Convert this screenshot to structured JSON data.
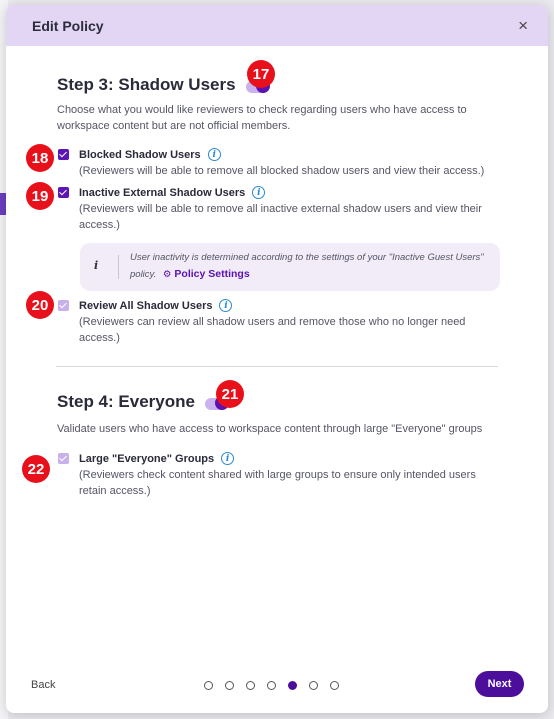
{
  "modal": {
    "title": "Edit Policy",
    "close_label": "×"
  },
  "step3": {
    "title": "Step 3: Shadow Users",
    "toggle_on": true,
    "description": "Choose what you would like reviewers to check regarding users who have access to workspace content but are not official members.",
    "options": [
      {
        "label": "Blocked Shadow Users",
        "checked": true,
        "description": "(Reviewers will be able to remove all blocked shadow users and view their access.)"
      },
      {
        "label": "Inactive External Shadow Users",
        "checked": true,
        "description": "(Reviewers will be able to remove all inactive external shadow users and view their access.)"
      },
      {
        "label": "Review All Shadow Users",
        "checked": true,
        "disabled": true,
        "description": "(Reviewers can review all shadow users and remove those who no longer need access.)"
      }
    ],
    "note": {
      "icon_text": "i",
      "text": "User inactivity is determined according to the settings of your \"Inactive Guest Users\" policy.",
      "link_label": "Policy Settings"
    }
  },
  "step4": {
    "title": "Step 4: Everyone",
    "toggle_on": true,
    "description": "Validate users who have access to workspace content through large \"Everyone\" groups",
    "options": [
      {
        "label": "Large \"Everyone\" Groups",
        "checked": true,
        "disabled": true,
        "description": "(Reviewers check content shared with large groups to ensure only intended users retain access.)"
      }
    ]
  },
  "badges": [
    "17",
    "18",
    "19",
    "20",
    "21",
    "22"
  ],
  "footer": {
    "back_label": "Back",
    "next_label": "Next",
    "page_count": 7,
    "active_page": 5
  },
  "colors": {
    "accent": "#4b0f9c",
    "header_bg": "#e3d6f5",
    "badge": "#e8111b",
    "info": "#2a8ad6"
  }
}
